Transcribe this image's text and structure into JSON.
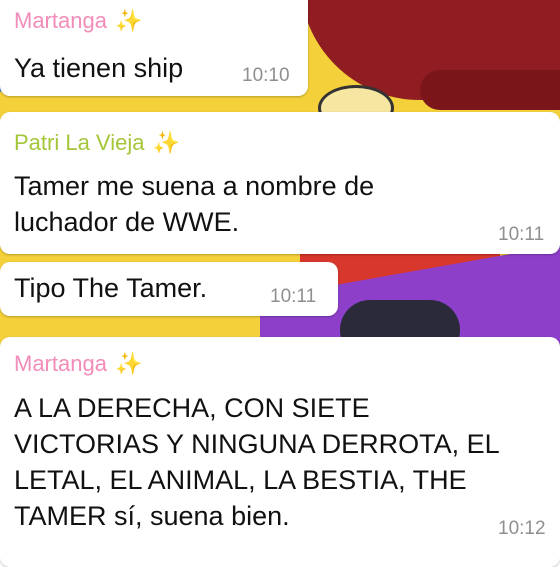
{
  "colors": {
    "martanga": "#f28cb8",
    "patri": "#a4c639",
    "sparkle": "#f2c200"
  },
  "messages": [
    {
      "sender": "Martanga",
      "sparkle": "✨",
      "lines": [
        "Ya tienen ship"
      ],
      "time": "10:10"
    },
    {
      "sender": "Patri La Vieja",
      "sparkle": "✨",
      "lines": [
        "Tamer me suena a nombre de",
        "luchador de WWE."
      ],
      "time": "10:11"
    },
    {
      "sender": "",
      "sparkle": "",
      "lines": [
        "Tipo The Tamer."
      ],
      "time": "10:11"
    },
    {
      "sender": "Martanga",
      "sparkle": "✨",
      "lines": [
        "A LA DERECHA, CON SIETE",
        "VICTORIAS Y NINGUNA DERROTA, EL",
        "LETAL, EL ANIMAL, LA BESTIA, THE",
        "TAMER sí, suena bien."
      ],
      "time": "10:12"
    }
  ]
}
